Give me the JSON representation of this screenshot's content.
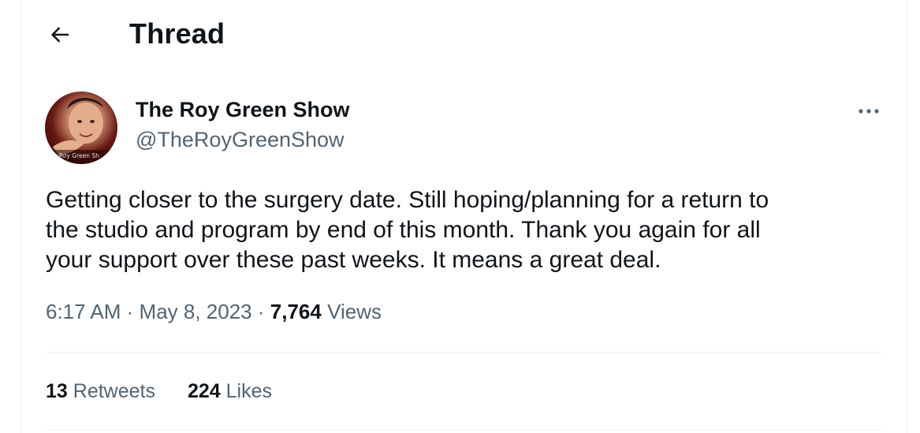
{
  "header": {
    "title": "Thread",
    "back_icon": "arrow-left-icon"
  },
  "tweet": {
    "author": {
      "display_name": "The Roy Green Show",
      "handle": "@TheRoyGreenShow",
      "avatar_caption": "Roy Green Sh"
    },
    "more_icon": "more-dots-icon",
    "text_lines": [
      "Getting closer to the surgery date. Still hoping/planning for a return to",
      "the studio and program by end of this month. Thank you again for all",
      "your support over these past weeks. It means a great deal."
    ],
    "meta": {
      "time": "6:17 AM",
      "separator": "·",
      "date": "May 8, 2023",
      "views_count": "7,764",
      "views_label": "Views"
    },
    "stats": {
      "retweets_count": "13",
      "retweets_label": "Retweets",
      "likes_count": "224",
      "likes_label": "Likes"
    }
  },
  "colors": {
    "text_primary": "#0f1419",
    "text_secondary": "#536471",
    "border": "#eff3f4"
  }
}
